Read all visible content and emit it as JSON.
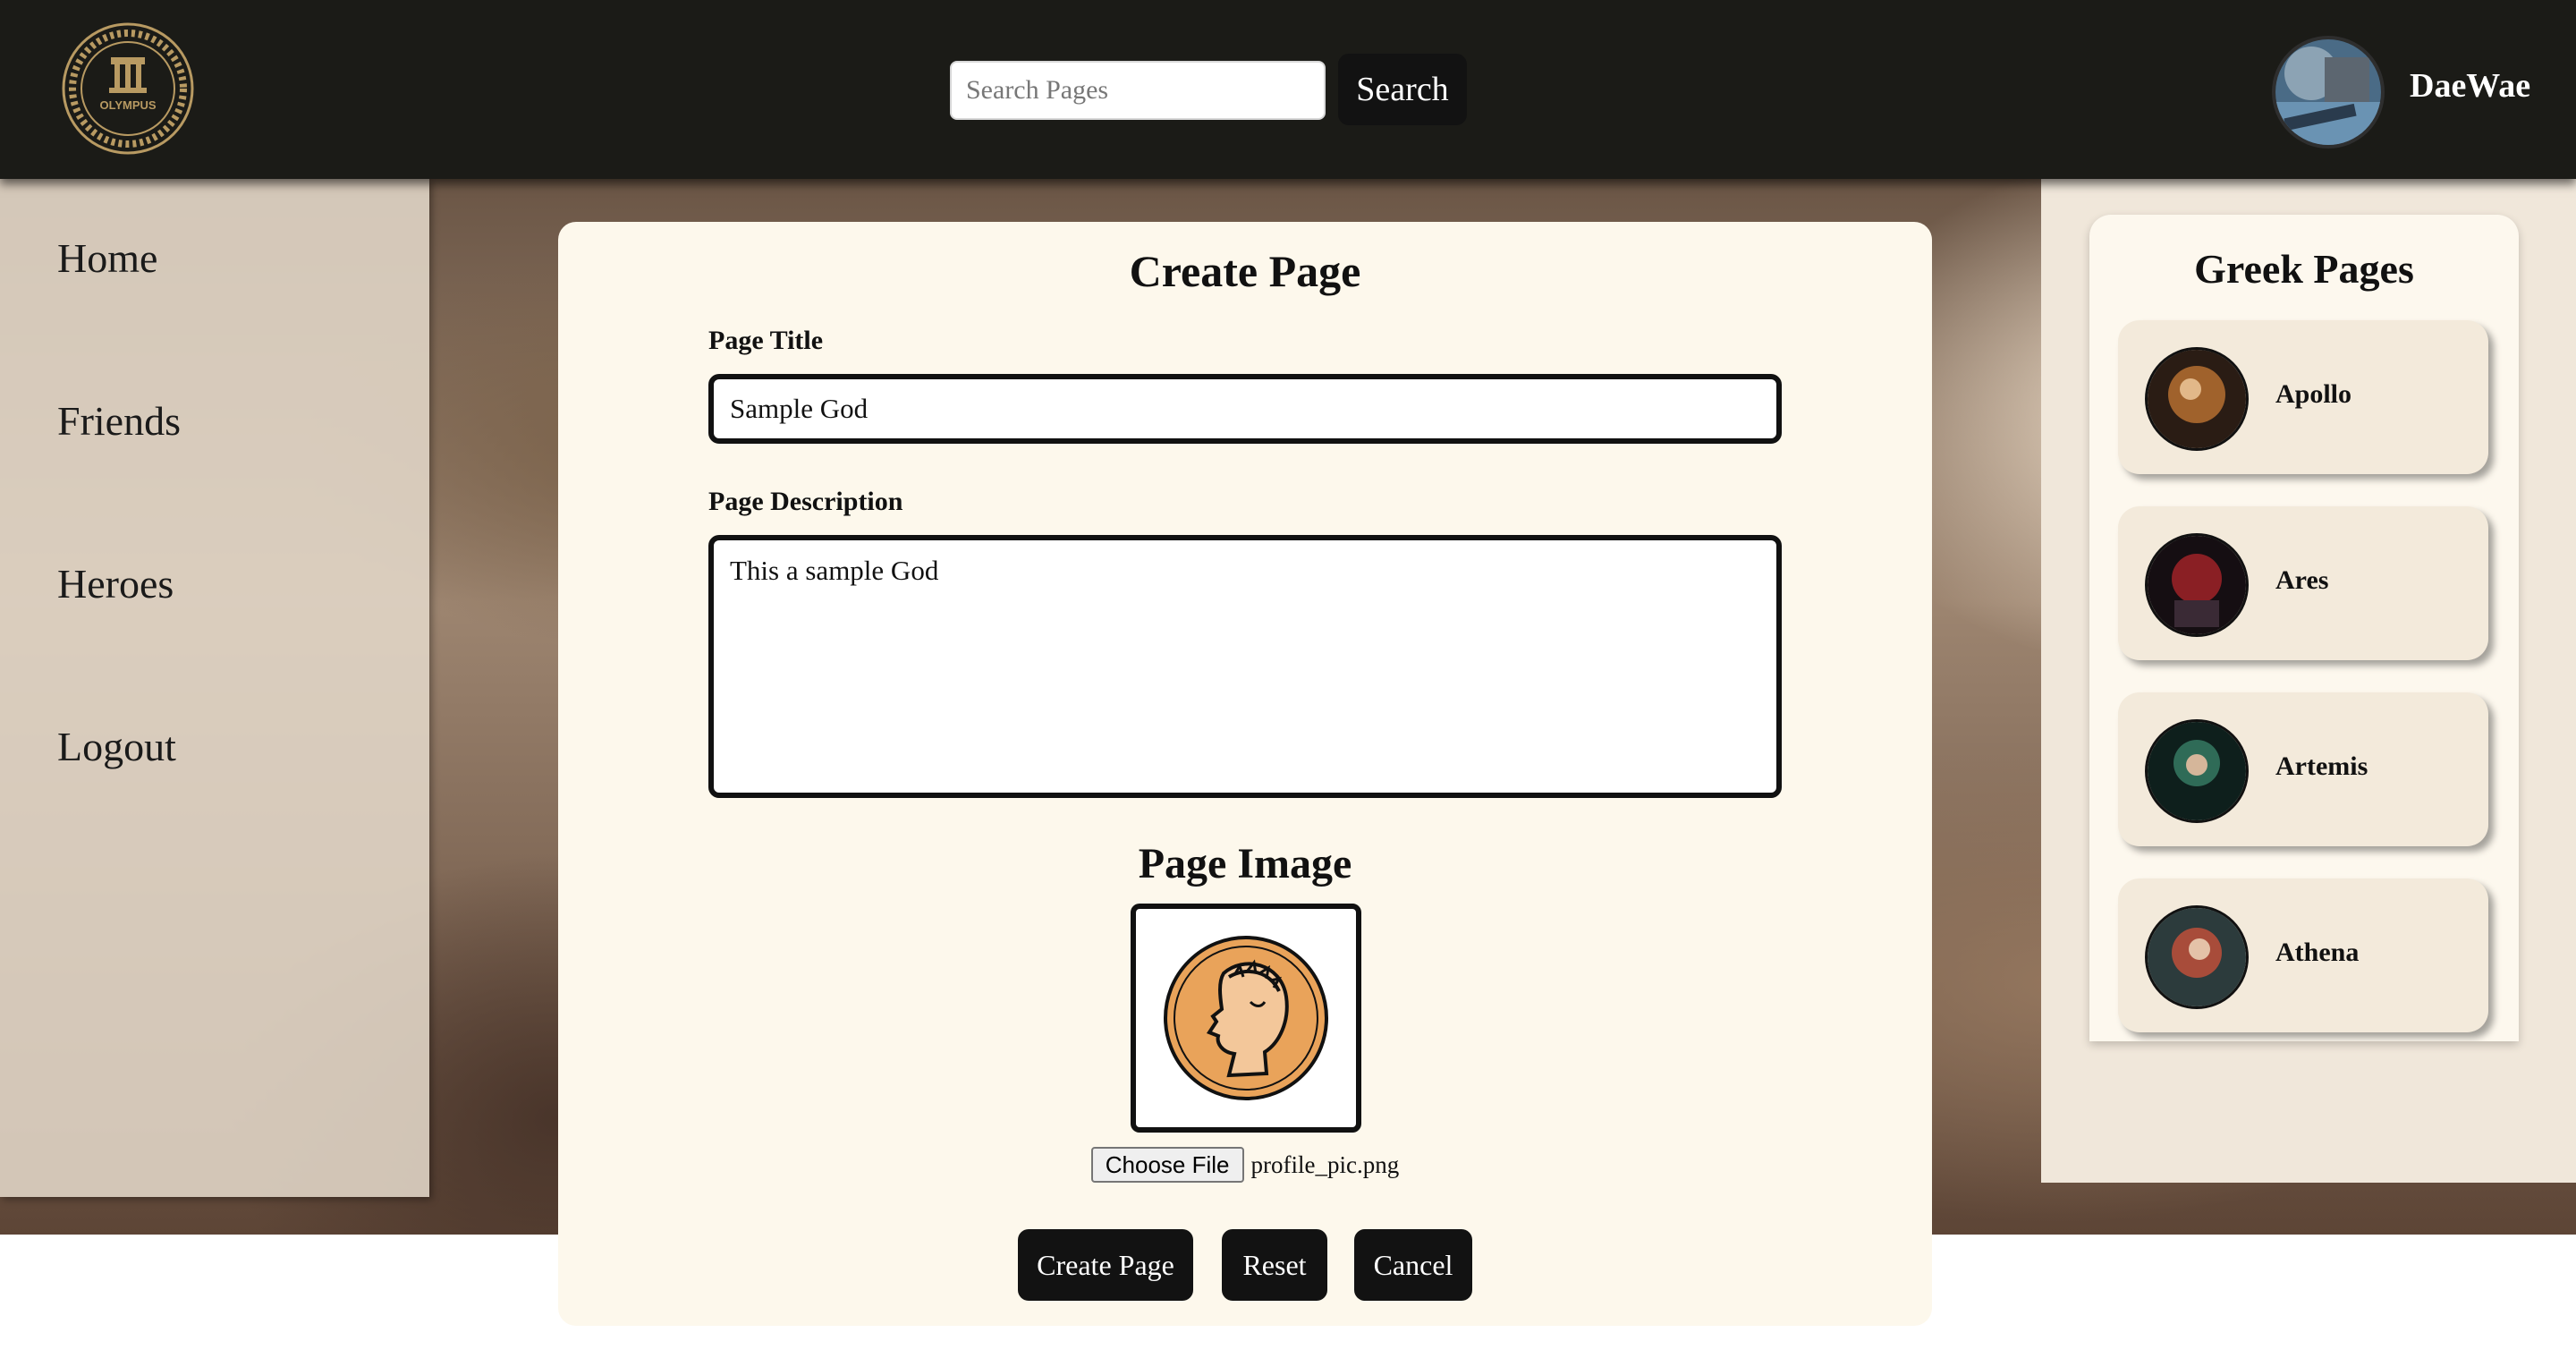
{
  "header": {
    "logo_text": "OLYMPUS",
    "search": {
      "placeholder": "Search Pages",
      "value": ""
    },
    "search_button": "Search",
    "username": "DaeWae"
  },
  "nav": {
    "items": [
      {
        "label": "Home"
      },
      {
        "label": "Friends"
      },
      {
        "label": "Heroes"
      },
      {
        "label": "Logout"
      }
    ]
  },
  "form": {
    "title": "Create Page",
    "page_title_label": "Page Title",
    "page_title_value": "Sample God",
    "page_description_label": "Page Description",
    "page_description_value": "This a sample God",
    "page_image_heading": "Page Image",
    "choose_file_label": "Choose File",
    "file_name": "profile_pic.png",
    "buttons": {
      "create": "Create Page",
      "reset": "Reset",
      "cancel": "Cancel"
    }
  },
  "greek_pages": {
    "title": "Greek Pages",
    "items": [
      {
        "name": "Apollo",
        "avatar_color": "#a0622c"
      },
      {
        "name": "Ares",
        "avatar_color": "#8a1f24"
      },
      {
        "name": "Artemis",
        "avatar_color": "#2f6b57"
      },
      {
        "name": "Athena",
        "avatar_color": "#a84c3a"
      }
    ]
  },
  "colors": {
    "header_bg": "#1b1b17",
    "button_bg": "#121212",
    "card_bg": "#fdf8ec",
    "coin_fill": "#e9a35a"
  }
}
